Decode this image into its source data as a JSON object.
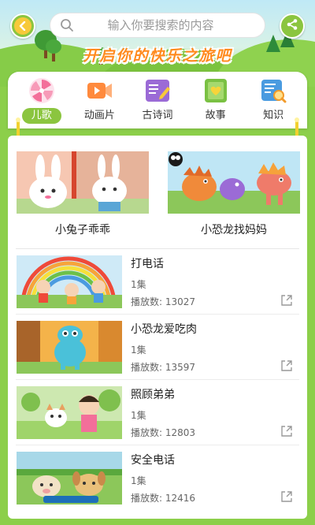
{
  "search": {
    "placeholder": "输入你要搜索的内容"
  },
  "header": {
    "slogan": "开启你的快乐之旅吧"
  },
  "categories": [
    {
      "label": "儿歌",
      "icon": "pinwheel-icon",
      "color": "#f36f9a",
      "active": true
    },
    {
      "label": "动画片",
      "icon": "video-camera-icon",
      "color": "#ff8a3d",
      "active": false
    },
    {
      "label": "古诗词",
      "icon": "poetry-book-icon",
      "color": "#9b6bd6",
      "active": false
    },
    {
      "label": "故事",
      "icon": "heart-book-icon",
      "color": "#7ac143",
      "active": false
    },
    {
      "label": "知识",
      "icon": "knowledge-search-icon",
      "color": "#4a9be0",
      "active": false
    }
  ],
  "featured": [
    {
      "title": "小兔子乖乖"
    },
    {
      "title": "小恐龙找妈妈"
    }
  ],
  "videos": [
    {
      "title": "打电话",
      "episodes": "1集",
      "plays": "播放数: 13027"
    },
    {
      "title": "小恐龙爱吃肉",
      "episodes": "1集",
      "plays": "播放数: 13597"
    },
    {
      "title": "照顾弟弟",
      "episodes": "1集",
      "plays": "播放数: 12803"
    },
    {
      "title": "安全电话",
      "episodes": "1集",
      "plays": "播放数: 12416"
    }
  ],
  "colors": {
    "accent": "#8bc53f",
    "background": "#8ccf4a",
    "slogan": "#ff8a1d"
  }
}
